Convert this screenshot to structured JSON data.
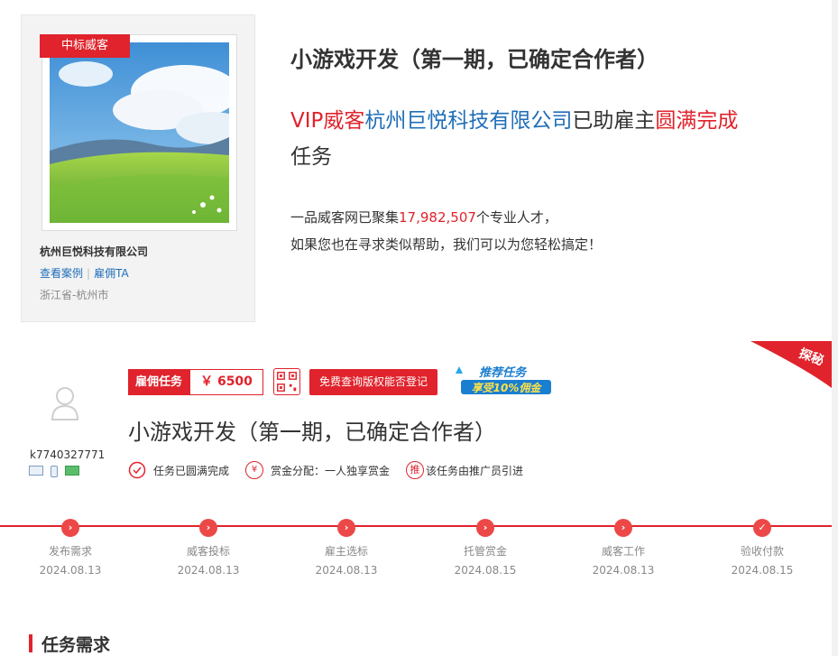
{
  "winner": {
    "tag": "中标威客",
    "company": "杭州巨悦科技有限公司",
    "link_cases": "查看案例",
    "link_hire": "雇佣TA",
    "location": "浙江省-杭州市"
  },
  "headline": {
    "title": "小游戏开发（第一期，已确定合作者）",
    "vip_prefix": "VIP威客",
    "vip_company": "杭州巨悦科技有限公司",
    "vip_middle": "已助雇主",
    "vip_done": "圆满完成",
    "vip_suffix": "任务",
    "stats_prefix": "一品威客网已聚集",
    "stats_count": "17,982,507",
    "stats_suffix": "个专业人才，",
    "stats_line2": "如果您也在寻求类似帮助，我们可以为您轻松搞定！"
  },
  "employer": {
    "username": "k7740327771"
  },
  "task": {
    "type_label": "雇佣任务",
    "price": "￥ 6500",
    "free_query": "免费查询版权能否登记",
    "promo_line1": "推荐任务",
    "promo_line2": "享受10%佣金",
    "corner_label": "探秘",
    "title": "小游戏开发（第一期，已确定合作者）",
    "badge_completed": "任务已圆满完成",
    "badge_reward": "赏金分配：一人独享赏金",
    "badge_promoter_icon": "推",
    "badge_promoter": "该任务由推广员引进",
    "reward_icon": "¥"
  },
  "progress": [
    {
      "label": "发布需求",
      "date": "2024.08.13",
      "icon": "chevron-right-icon"
    },
    {
      "label": "威客投标",
      "date": "2024.08.13",
      "icon": "chevron-right-icon"
    },
    {
      "label": "雇主选标",
      "date": "2024.08.13",
      "icon": "chevron-right-icon"
    },
    {
      "label": "托管赏金",
      "date": "2024.08.15",
      "icon": "chevron-right-icon"
    },
    {
      "label": "威客工作",
      "date": "2024.08.13",
      "icon": "chevron-right-icon"
    },
    {
      "label": "验收付款",
      "date": "2024.08.15",
      "icon": "check-icon"
    }
  ],
  "requirements": {
    "heading": "任务需求"
  },
  "colors": {
    "accent": "#e0232c",
    "link": "#1f6eb8"
  }
}
